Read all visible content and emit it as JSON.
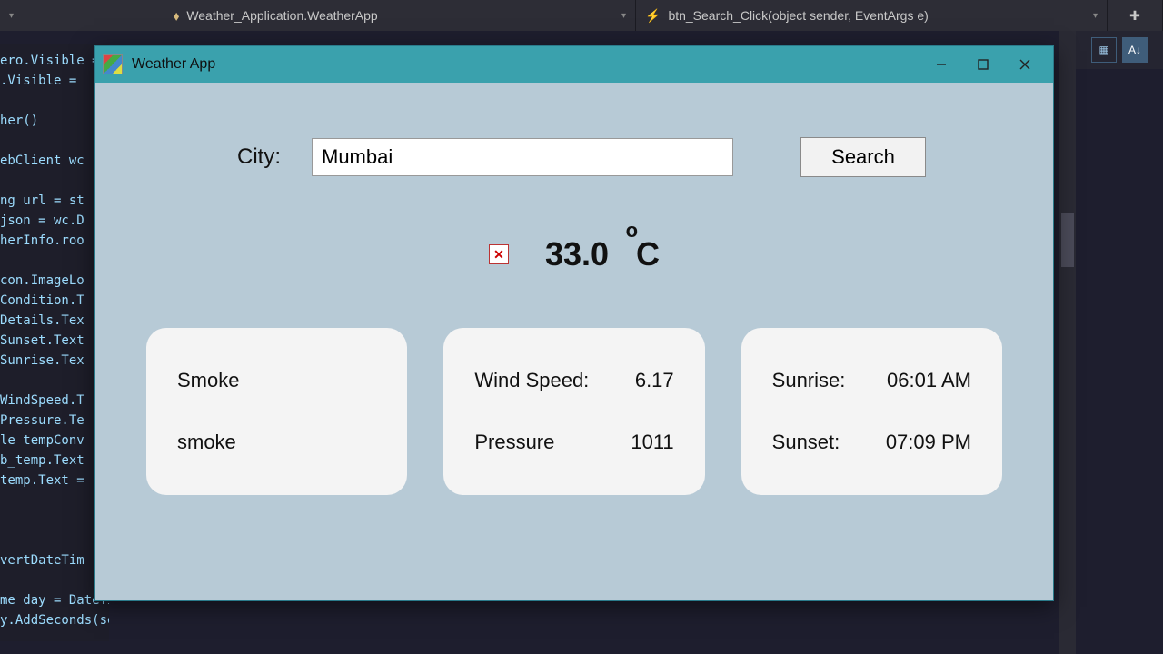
{
  "vs": {
    "breadcrumb_class": "Weather_Application.WeatherApp",
    "breadcrumb_method": "btn_Search_Click(object sender, EventArgs e)",
    "code_lines": [
      "ero.Visible = true;",
      ".Visible = ",
      "",
      "her()",
      "",
      "ebClient wc",
      "",
      "ng url = st",
      "json = wc.D",
      "herInfo.roo",
      "",
      "con.ImageLo",
      "Condition.T",
      "Details.Tex",
      "Sunset.Text",
      "Sunrise.Tex",
      "",
      "WindSpeed.T",
      "Pressure.Te",
      "le tempConv",
      "b_temp.Text",
      "temp.Text =",
      "",
      "",
      "",
      "vertDateTim",
      "",
      "me day = DateTime.Now;",
      "y.AddSeconds(sec); */"
    ]
  },
  "window": {
    "title": "Weather App"
  },
  "search": {
    "city_label": "City:",
    "city_value": "Mumbai",
    "button_label": "Search"
  },
  "temperature": {
    "value": "33.0",
    "unit": "C"
  },
  "condition": {
    "main": "Smoke",
    "detail": "smoke"
  },
  "wind": {
    "label": "Wind Speed:",
    "value": "6.17"
  },
  "pressure": {
    "label": "Pressure",
    "value": "1011"
  },
  "sun": {
    "sunrise_label": "Sunrise:",
    "sunrise_value": "06:01 AM",
    "sunset_label": "Sunset:",
    "sunset_value": "07:09 PM"
  }
}
